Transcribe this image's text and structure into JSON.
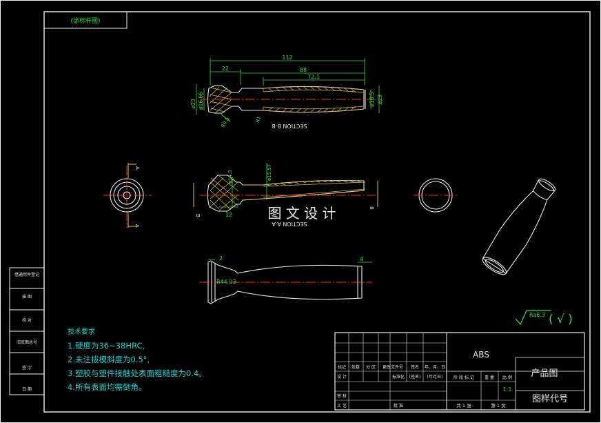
{
  "stamp": "(涂标杆图)",
  "dims": {
    "overall_length": "112",
    "left_len": "22",
    "len_88": "88",
    "len_72": "72.1",
    "dia_23_left": "ø23",
    "dia_16": "ø16.66",
    "r_left": "R0.5",
    "r_mid": "R1",
    "dia_18": "ø18.5",
    "dia_23_right": "ø23",
    "dia_14": "ø14.5",
    "dia_15": "ø15.57",
    "len_12": "12",
    "len_2": "2",
    "len_4": "4",
    "r_44": "R44.03"
  },
  "sections": {
    "bb": "SECTION B-B",
    "aa": "SECTION A-A",
    "label_a": "A",
    "label_b": "B"
  },
  "watermark": "图 文 设 计",
  "roughness": {
    "value": "Ra6.3",
    "suffix": "( √ )"
  },
  "side_table": [
    "借通用件登记",
    "描 图",
    "校 对",
    "旧底图总号",
    "签 字",
    "日 期"
  ],
  "tech_notes": {
    "heading": "技术要求",
    "items": [
      "1.硬度为36~38HRC,",
      "2.未注拔模斜度为0.5°,",
      "3.塑胶与塑件接触处表面粗糙度为0.4。",
      "4.所有表面均需倒角。"
    ]
  },
  "title_block": {
    "material": "ABS",
    "product_name": "产品图",
    "drawing_code": "图样代号",
    "scale": "1:1",
    "header_cells": [
      "标记",
      "处数",
      "分 区",
      "更改文件号",
      "签名",
      "年、月、日"
    ],
    "design": "设 计",
    "standardization": "标准化",
    "sign": "(签名)",
    "date": "(年月日)",
    "stage_headers": [
      "阶 段 标 记",
      "重 量",
      "比 例"
    ],
    "review": "审 核",
    "process": "工 艺",
    "approve": "批 准",
    "sheets_total": "共 1 张",
    "sheet_no": "第 1 页"
  }
}
